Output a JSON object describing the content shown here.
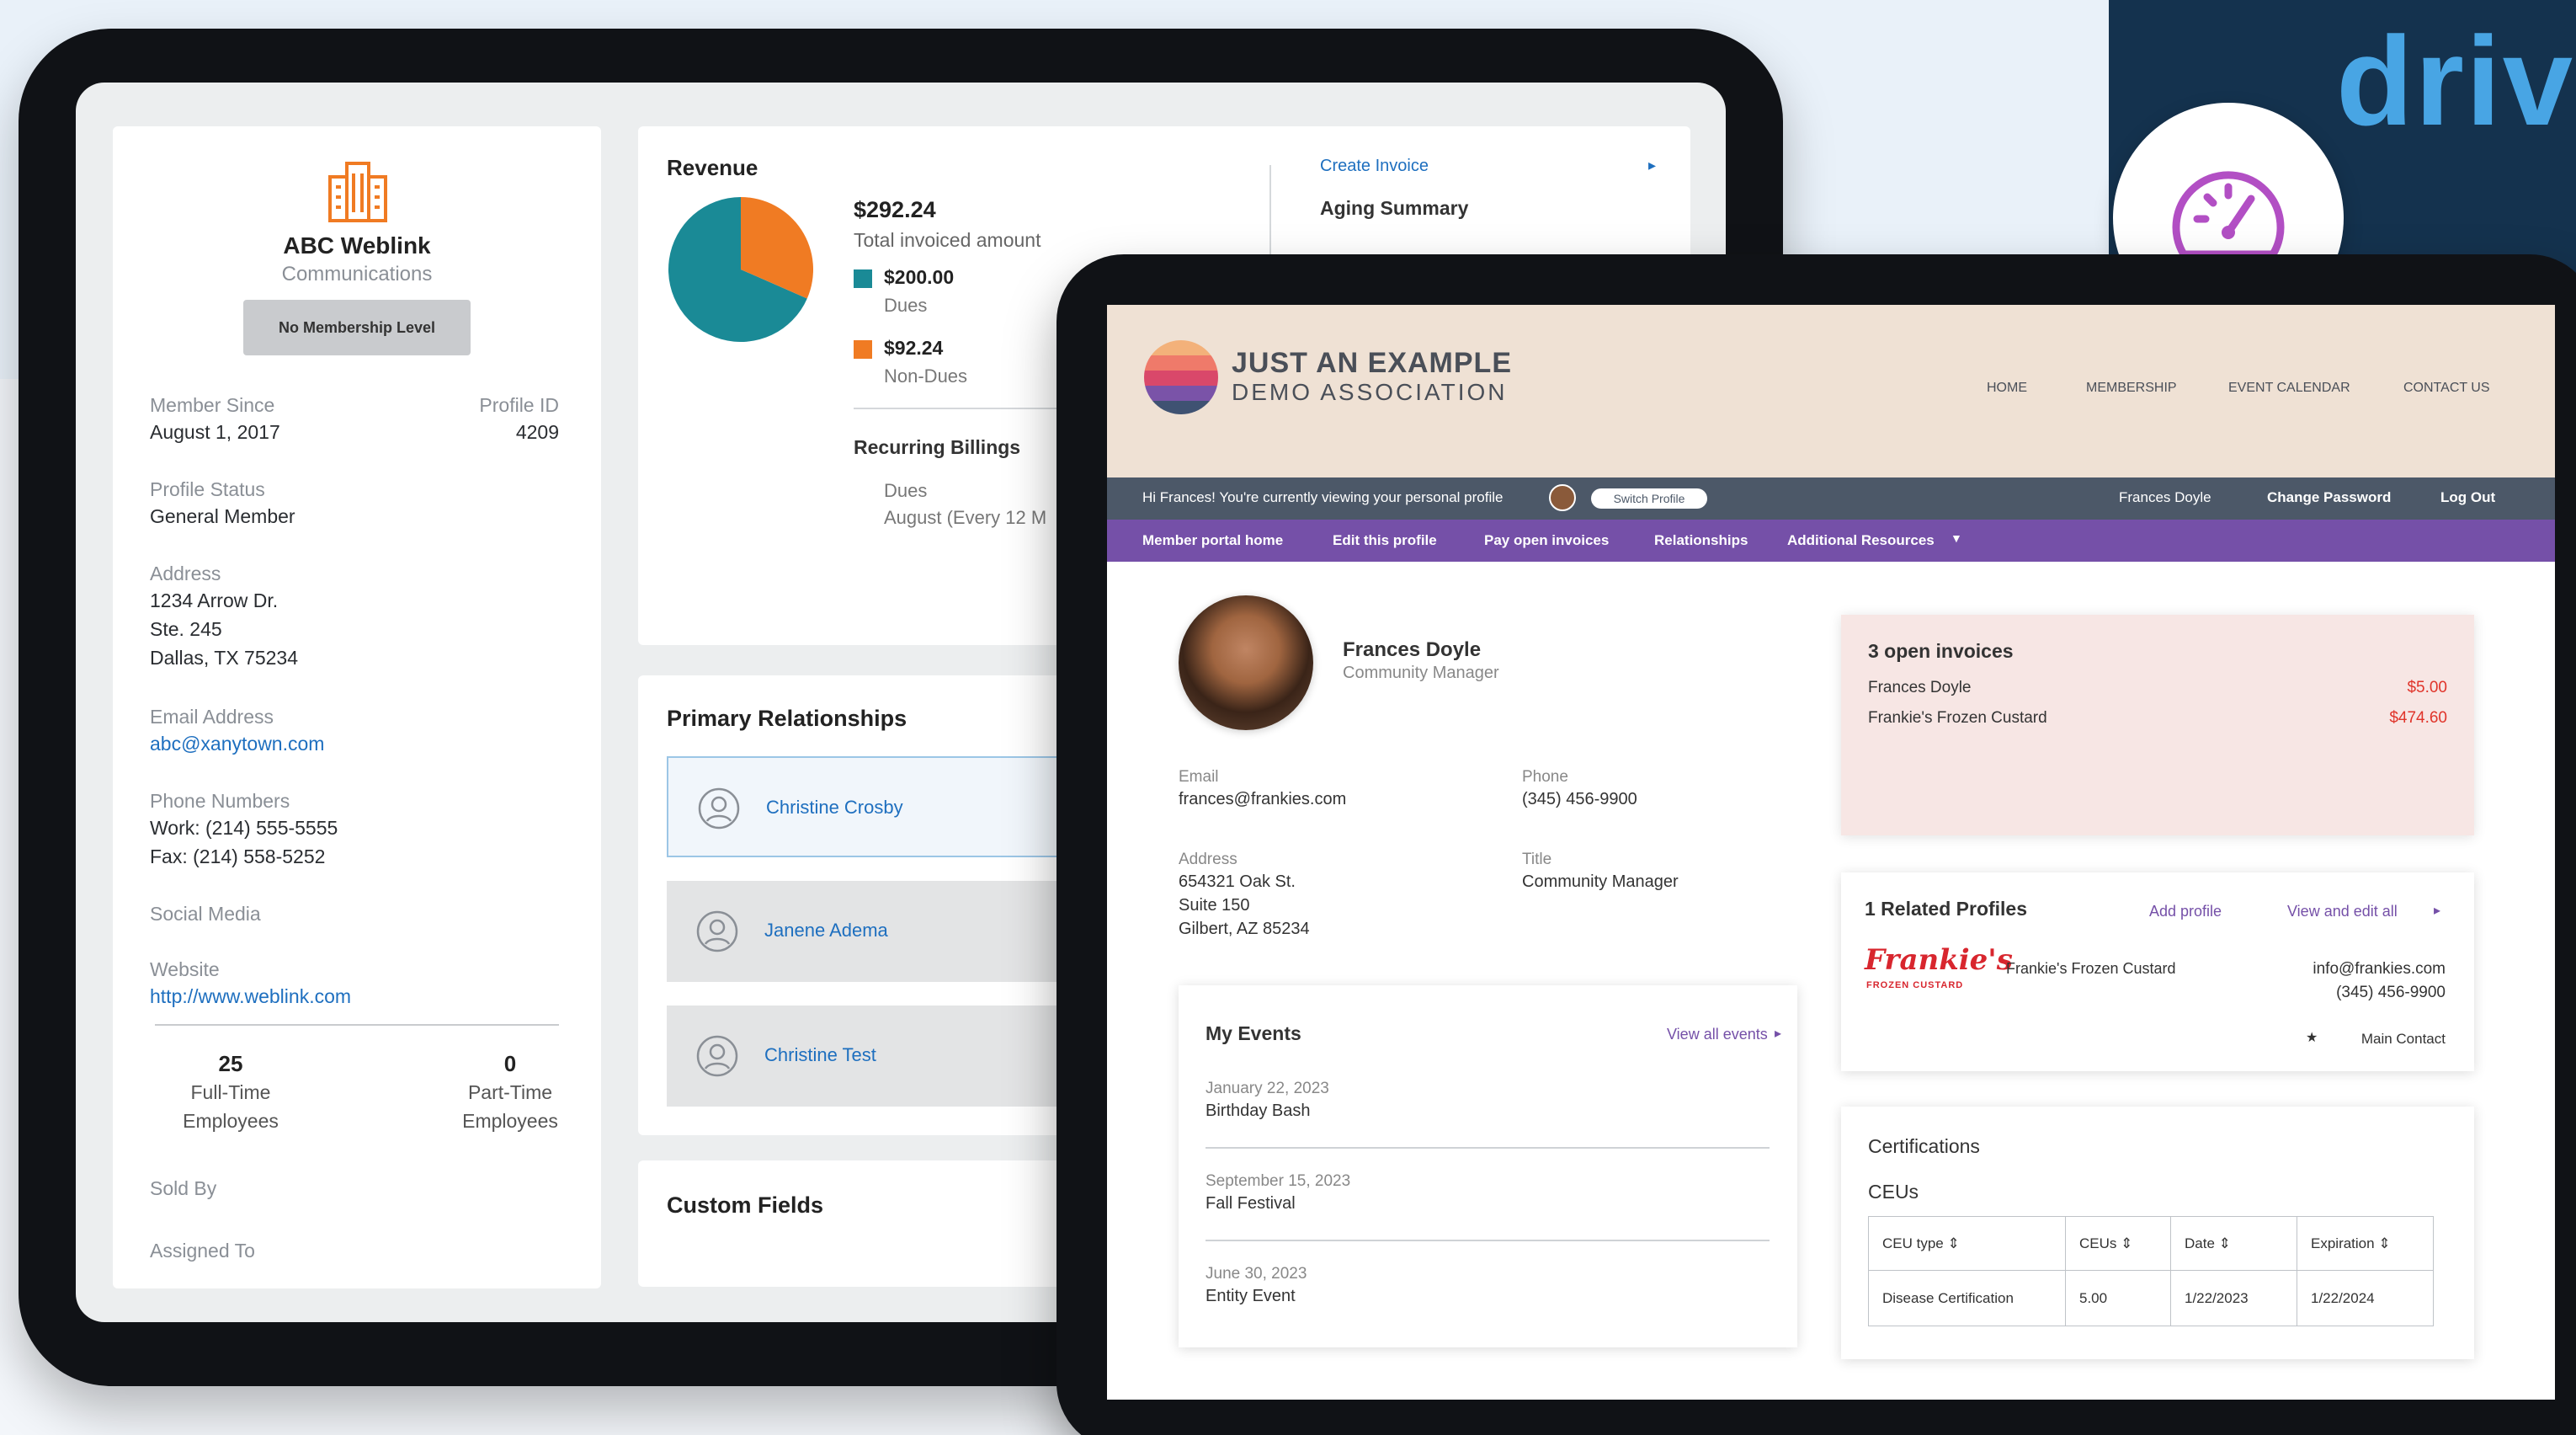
{
  "brand": {
    "text": "driv"
  },
  "left_app": {
    "profile": {
      "company_name": "ABC Weblink",
      "company_subtitle": "Communications",
      "membership_badge": "No Membership Level",
      "member_since_label": "Member Since",
      "member_since_value": "August 1, 2017",
      "profile_id_label": "Profile ID",
      "profile_id_value": "4209",
      "status_label": "Profile Status",
      "status_value": "General Member",
      "address_label": "Address",
      "address_lines": [
        "1234 Arrow Dr.",
        "Ste. 245",
        "Dallas, TX 75234"
      ],
      "email_label": "Email Address",
      "email_value": "abc@xanytown.com",
      "phone_label": "Phone Numbers",
      "phone_work": "Work: (214) 555-5555",
      "phone_fax": "Fax: (214) 558-5252",
      "social_label": "Social Media",
      "website_label": "Website",
      "website_value": "http://www.weblink.com",
      "fulltime_count": "25",
      "fulltime_label_1": "Full-Time",
      "fulltime_label_2": "Employees",
      "parttime_count": "0",
      "parttime_label_1": "Part-Time",
      "parttime_label_2": "Employees",
      "sold_by_label": "Sold By",
      "assigned_to_label": "Assigned To"
    },
    "revenue": {
      "title": "Revenue",
      "total_amount": "$292.24",
      "total_label": "Total invoiced amount",
      "dues_amount": "$200.00",
      "dues_label": "Dues",
      "nondues_amount": "$92.24",
      "nondues_label": "Non-Dues",
      "recurring_title": "Recurring Billings",
      "recurring_item": "Dues",
      "recurring_sub": "August (Every 12 M",
      "create_invoice": "Create Invoice",
      "aging_summary": "Aging Summary",
      "colors": {
        "dues": "#1a8a96",
        "nondues": "#f07b23"
      },
      "dues_value": 200.0,
      "nondues_value": 92.24
    },
    "relationships": {
      "title": "Primary Relationships",
      "items": [
        "Christine Crosby",
        "Janene Adema",
        "Christine Test"
      ]
    },
    "custom_fields": {
      "title": "Custom Fields"
    }
  },
  "portal": {
    "logo_line1": "JUST AN EXAMPLE",
    "logo_line2": "DEMO ASSOCIATION",
    "nav": [
      "HOME",
      "MEMBERSHIP",
      "EVENT CALENDAR",
      "CONTACT US"
    ],
    "user_bar": {
      "greeting": "Hi Frances! You're currently viewing your personal profile",
      "switch_profile": "Switch Profile",
      "user_name": "Frances Doyle",
      "change_password": "Change Password",
      "log_out": "Log Out"
    },
    "menu": [
      "Member portal home",
      "Edit this profile",
      "Pay open invoices",
      "Relationships",
      "Additional Resources"
    ],
    "profile": {
      "name": "Frances Doyle",
      "title": "Community Manager",
      "email_label": "Email",
      "email_value": "frances@frankies.com",
      "phone_label": "Phone",
      "phone_value": "(345) 456-9900",
      "address_label": "Address",
      "address_lines": [
        "654321 Oak St.",
        "Suite 150",
        "Gilbert, AZ 85234"
      ],
      "title_label": "Title",
      "title_value": "Community Manager"
    },
    "events": {
      "title": "My Events",
      "view_all": "View all events",
      "items": [
        {
          "date": "January 22, 2023",
          "name": "Birthday Bash"
        },
        {
          "date": "September 15, 2023",
          "name": "Fall Festival"
        },
        {
          "date": "June 30, 2023",
          "name": "Entity Event"
        }
      ]
    },
    "invoices": {
      "title": "3 open invoices",
      "rows": [
        {
          "name": "Frances Doyle",
          "amount": "$5.00"
        },
        {
          "name": "Frankie's Frozen Custard",
          "amount": "$474.60"
        }
      ]
    },
    "related": {
      "title": "1 Related Profiles",
      "add_profile": "Add profile",
      "view_edit": "View and edit all",
      "logo_text": "Frankie's",
      "logo_sub": "FROZEN CUSTARD",
      "company": "Frankie's Frozen Custard",
      "email": "info@frankies.com",
      "phone": "(345) 456-9900",
      "main_contact": "Main Contact"
    },
    "certifications": {
      "title": "Certifications",
      "subtitle": "CEUs",
      "headers": [
        "CEU type",
        "CEUs",
        "Date",
        "Expiration"
      ],
      "rows": [
        [
          "Disease Certification",
          "5.00",
          "1/22/2023",
          "1/22/2024"
        ]
      ]
    }
  }
}
